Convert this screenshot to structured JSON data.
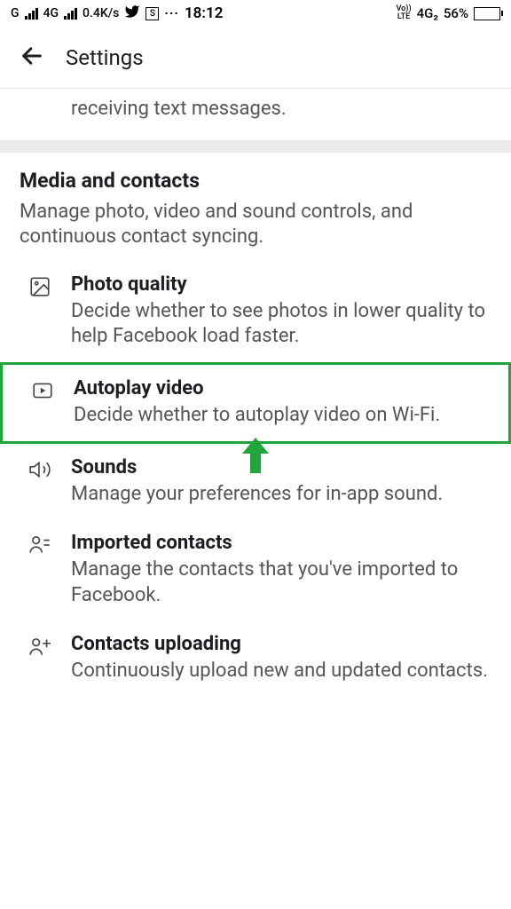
{
  "status_bar": {
    "left": {
      "net1": "G",
      "net2": "4G",
      "speed": "0.4K/s",
      "s_label": "S"
    },
    "time": "18:12",
    "right": {
      "volte_top": "Vo))",
      "volte_bottom": "LTE",
      "net": "4G₂",
      "battery_pct": "56%"
    }
  },
  "header": {
    "title": "Settings"
  },
  "partial": {
    "text": "receiving text messages."
  },
  "section": {
    "title": "Media and contacts",
    "desc": "Manage photo, video and sound controls, and continuous contact syncing.",
    "items": [
      {
        "title": "Photo quality",
        "desc": "Decide whether to see photos in lower quality to help Facebook load faster."
      },
      {
        "title": "Autoplay video",
        "desc": "Decide whether to autoplay video on Wi-Fi."
      },
      {
        "title": "Sounds",
        "desc": "Manage your preferences for in-app sound."
      },
      {
        "title": "Imported contacts",
        "desc": "Manage the contacts that you've imported to Facebook."
      },
      {
        "title": "Contacts uploading",
        "desc": "Continuously upload new and updated contacts."
      }
    ]
  }
}
